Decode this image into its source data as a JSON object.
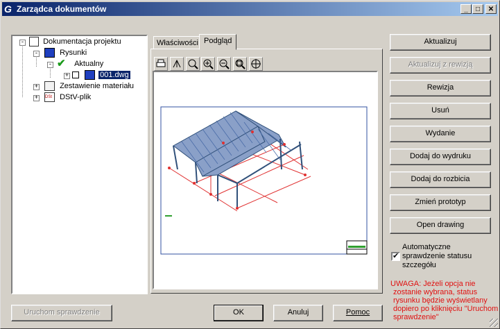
{
  "window": {
    "title": "Zarządca dokumentów"
  },
  "tree": {
    "root": "Dokumentacja projektu",
    "drawings": "Rysunki",
    "current": "Aktualny",
    "file": "001.dwg",
    "materials": "Zestawienie materiału",
    "dstv": "DStV-plik"
  },
  "tabs": {
    "properties": "Właściwości",
    "preview": "Podgląd"
  },
  "buttons": {
    "update": "Aktualizuj",
    "update_revision": "Aktualizuj z rewizją",
    "revision": "Rewizja",
    "delete": "Usuń",
    "issue": "Wydanie",
    "add_print": "Dodaj do wydruku",
    "add_split": "Dodaj do rozbicia",
    "change_prototype": "Zmień prototyp",
    "open_drawing": "Open drawing",
    "run_check": "Uruchom sprawdzenie",
    "ok": "OK",
    "cancel": "Anuluj",
    "help": "Pomoc"
  },
  "auto_check": {
    "label_line1": "Automatyczne",
    "label_line2": "sprawdzenie statusu",
    "label_line3": "szczegółu",
    "checked": true
  },
  "warning": {
    "line1": "UWAGA: Jeżeli opcja nie",
    "line2": "zostanie wybrana, status",
    "line3": "rysunku będzie wyświetlany",
    "line4": "dopiero po kliknięciu \"Uruchom",
    "line5": "sprawdzenie\""
  },
  "colors": {
    "titlebar_start": "#0a246a",
    "warning_text": "#e01010",
    "selection": "#0a246a"
  }
}
